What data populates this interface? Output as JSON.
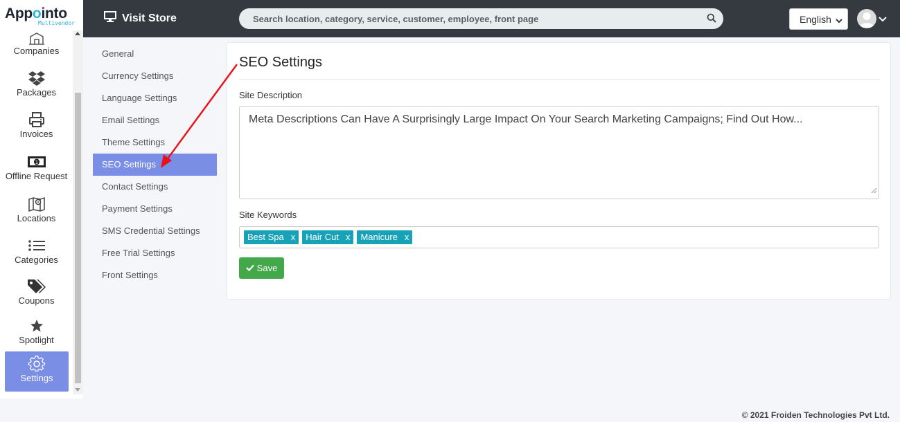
{
  "brand": {
    "name_part1": "App",
    "name_dot": "o",
    "name_part2": "into",
    "subtitle": "Multivendor"
  },
  "sidebar": {
    "items": [
      {
        "label": "Companies",
        "icon": "building-icon"
      },
      {
        "label": "Packages",
        "icon": "dropbox-icon"
      },
      {
        "label": "Invoices",
        "icon": "printer-icon"
      },
      {
        "label": "Offline Request",
        "icon": "money-icon"
      },
      {
        "label": "Locations",
        "icon": "map-icon"
      },
      {
        "label": "Categories",
        "icon": "list-icon"
      },
      {
        "label": "Coupons",
        "icon": "tags-icon"
      },
      {
        "label": "Spotlight",
        "icon": "star-icon"
      },
      {
        "label": "Settings",
        "icon": "gear-icon",
        "active": true
      }
    ]
  },
  "topbar": {
    "visit_store": "Visit Store",
    "search_placeholder": "Search location, category, service, customer, employee, front page",
    "language": "English"
  },
  "submenu": {
    "items": [
      "General",
      "Currency Settings",
      "Language Settings",
      "Email Settings",
      "Theme Settings",
      "SEO Settings",
      "Contact Settings",
      "Payment Settings",
      "SMS Credential Settings",
      "Free Trial Settings",
      "Front Settings"
    ],
    "active_index": 5
  },
  "seo": {
    "title": "SEO Settings",
    "description_label": "Site Description",
    "description_value": "Meta Descriptions Can Have A Surprisingly Large Impact On Your Search Marketing Campaigns; Find Out How...",
    "keywords_label": "Site Keywords",
    "keywords": [
      "Best Spa",
      "Hair Cut",
      "Manicure"
    ],
    "tag_remove": "x",
    "save_label": "Save"
  },
  "footer": {
    "copyright": "© 2021 Froiden Technologies Pvt Ltd."
  },
  "colors": {
    "accent": "#7b8ee6",
    "topbar": "#343a40",
    "tag": "#17a2b8",
    "save": "#43a84a",
    "arrow": "#e8141c"
  }
}
